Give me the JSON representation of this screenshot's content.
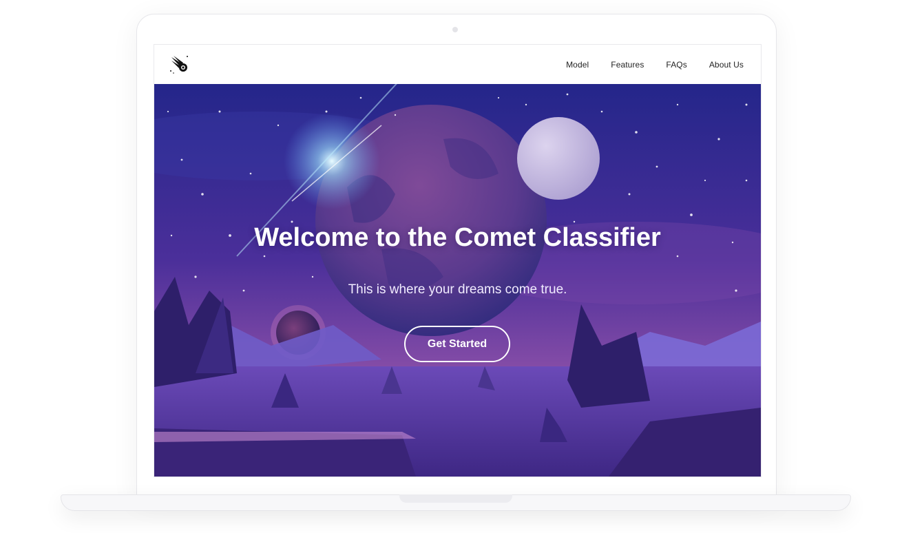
{
  "nav": {
    "logo_icon": "comet-icon",
    "links": [
      "Model",
      "Features",
      "FAQs",
      "About Us"
    ]
  },
  "hero": {
    "title": "Welcome to the Comet Classifier",
    "subtitle": "This is where your dreams come true.",
    "cta_label": "Get Started"
  },
  "colors": {
    "sky_top": "#2a2a8c",
    "sky_bottom": "#8a4fa8",
    "planet": "#6a3f8a",
    "moon": "#c7bde0",
    "ground": "#4b2d8f",
    "cta_border": "#ffffff"
  }
}
